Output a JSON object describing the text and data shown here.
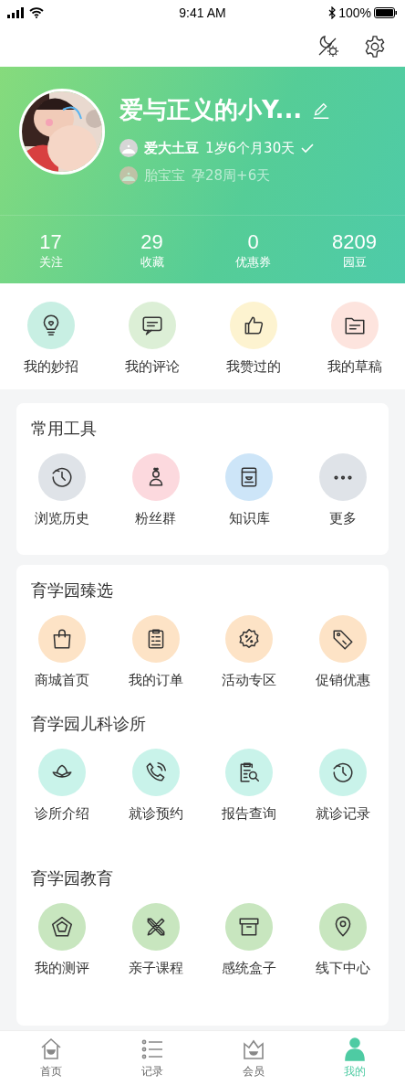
{
  "status_bar": {
    "time": "9:41 AM",
    "battery": "100%"
  },
  "profile": {
    "name": "爱与正义的小Y...",
    "children": [
      {
        "name": "爱大土豆",
        "age": "1岁6个月30天",
        "selected": true
      },
      {
        "name": "胎宝宝",
        "age": "孕28周+6天",
        "selected": false
      }
    ]
  },
  "stats": [
    {
      "value": "17",
      "label": "关注"
    },
    {
      "value": "29",
      "label": "收藏"
    },
    {
      "value": "0",
      "label": "优惠券"
    },
    {
      "value": "8209",
      "label": "园豆"
    }
  ],
  "quick_actions": [
    {
      "label": "我的妙招",
      "color": "#c8efe3"
    },
    {
      "label": "我的评论",
      "color": "#dcefd6"
    },
    {
      "label": "我赞过的",
      "color": "#fdf3d0"
    },
    {
      "label": "我的草稿",
      "color": "#fde4de"
    }
  ],
  "cards": [
    {
      "sections": [
        {
          "title": "常用工具",
          "items": [
            {
              "label": "浏览历史",
              "color": "#dfe3e8"
            },
            {
              "label": "粉丝群",
              "color": "#fcd9de"
            },
            {
              "label": "知识库",
              "color": "#cde5f8"
            },
            {
              "label": "更多",
              "color": "#dfe3e8"
            }
          ]
        }
      ]
    },
    {
      "sections": [
        {
          "title": "育学园臻选",
          "items": [
            {
              "label": "商城首页",
              "color": "#fde3c6"
            },
            {
              "label": "我的订单",
              "color": "#fde3c6"
            },
            {
              "label": "活动专区",
              "color": "#fde3c6"
            },
            {
              "label": "促销优惠",
              "color": "#fde3c6"
            }
          ]
        },
        {
          "title": "育学园儿科诊所",
          "items": [
            {
              "label": "诊所介绍",
              "color": "#c9f3ea"
            },
            {
              "label": "就诊预约",
              "color": "#c9f3ea"
            },
            {
              "label": "报告查询",
              "color": "#c9f3ea"
            },
            {
              "label": "就诊记录",
              "color": "#c9f3ea"
            }
          ]
        },
        {
          "title": "育学园教育",
          "items": [
            {
              "label": "我的测评",
              "color": "#c8e6bf"
            },
            {
              "label": "亲子课程",
              "color": "#c8e6bf"
            },
            {
              "label": "感统盒子",
              "color": "#c8e6bf"
            },
            {
              "label": "线下中心",
              "color": "#c8e6bf"
            }
          ]
        }
      ]
    }
  ],
  "tab_bar": [
    {
      "label": "首页",
      "selected": false
    },
    {
      "label": "记录",
      "selected": false
    },
    {
      "label": "会员",
      "selected": false
    },
    {
      "label": "我的",
      "selected": true
    }
  ]
}
